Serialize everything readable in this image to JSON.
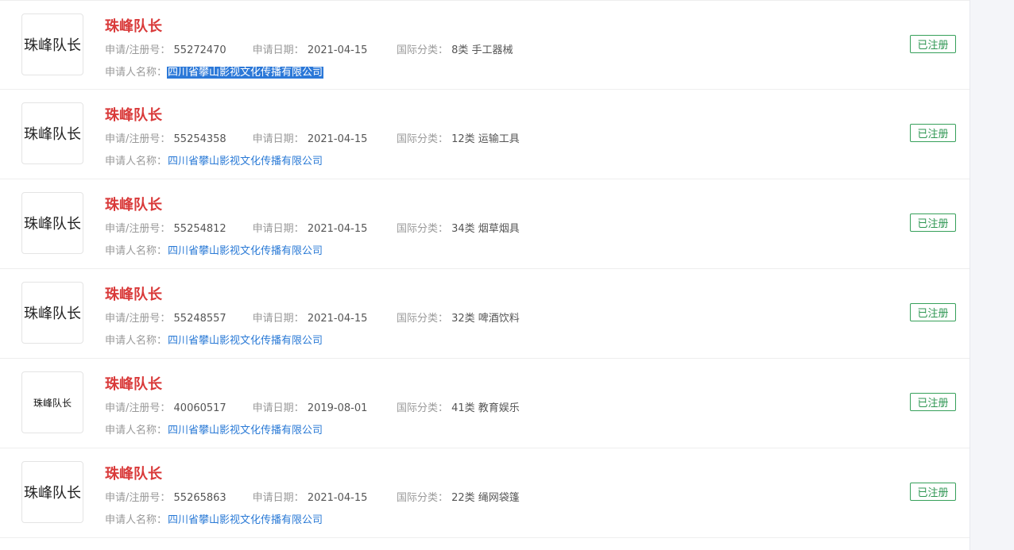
{
  "labels": {
    "reg_no": "申请/注册号：",
    "date": "申请日期：",
    "class": "国际分类：",
    "applicant": "申请人名称："
  },
  "items": [
    {
      "logo_text": "珠峰队长",
      "name": "珠峰队长",
      "reg_no": "55272470",
      "date": "2021-04-15",
      "class": "8类 手工器械",
      "applicant": "四川省攀山影视文化传播有限公司",
      "status": "已注册"
    },
    {
      "logo_text": "珠峰队长",
      "name": "珠峰队长",
      "reg_no": "55254358",
      "date": "2021-04-15",
      "class": "12类 运输工具",
      "applicant": "四川省攀山影视文化传播有限公司",
      "status": "已注册"
    },
    {
      "logo_text": "珠峰队长",
      "name": "珠峰队长",
      "reg_no": "55254812",
      "date": "2021-04-15",
      "class": "34类 烟草烟具",
      "applicant": "四川省攀山影视文化传播有限公司",
      "status": "已注册"
    },
    {
      "logo_text": "珠峰队长",
      "name": "珠峰队长",
      "reg_no": "55248557",
      "date": "2021-04-15",
      "class": "32类 啤酒饮料",
      "applicant": "四川省攀山影视文化传播有限公司",
      "status": "已注册"
    },
    {
      "logo_text": "珠峰队长",
      "name": "珠峰队长",
      "reg_no": "40060517",
      "date": "2019-08-01",
      "class": "41类 教育娱乐",
      "applicant": "四川省攀山影视文化传播有限公司",
      "status": "已注册"
    },
    {
      "logo_text": "珠峰队长",
      "name": "珠峰队长",
      "reg_no": "55265863",
      "date": "2021-04-15",
      "class": "22类 绳网袋篷",
      "applicant": "四川省攀山影视文化传播有限公司",
      "status": "已注册"
    }
  ],
  "colors": {
    "name": "#d93a3a",
    "link": "#2a7ad6",
    "status": "#2e9652",
    "selection": "#2b78d8"
  }
}
